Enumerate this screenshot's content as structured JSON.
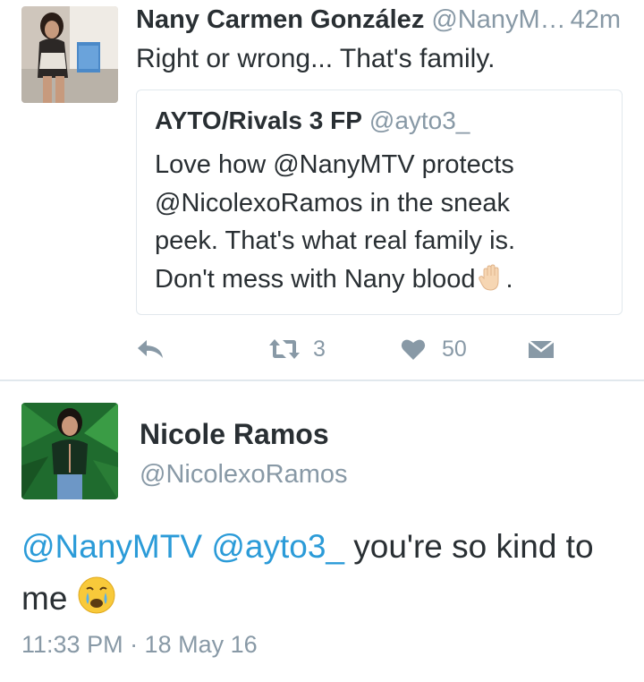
{
  "tweet1": {
    "name": "Nany Carmen González",
    "handle": "@NanyM…",
    "time": "42m",
    "text": "Right or wrong... That's family.",
    "quote": {
      "name": "AYTO/Rivals 3 FP",
      "handle": "@ayto3_",
      "lines": [
        "Love how @NanyMTV protects",
        "@NicolexoRamos in the sneak",
        "peek. That's what real family is.",
        "Don't mess with Nany blood"
      ],
      "end_punct": ".",
      "emoji": "raised-hand-emoji"
    },
    "actions": {
      "retweet_count": "3",
      "like_count": "50"
    }
  },
  "tweet2": {
    "name": "Nicole Ramos",
    "handle": "@NicolexoRamos",
    "mention1": "@NanyMTV",
    "mention2": "@ayto3_",
    "text_line1_rest": " you're so kind to",
    "text_line2": "me",
    "emoji": "crying-face-emoji",
    "meta": "11:33 PM · 18 May 16"
  },
  "colors": {
    "text": "#292f33",
    "secondary": "#8899a6",
    "link": "#2b9bd8",
    "border": "#e1e8ed"
  }
}
